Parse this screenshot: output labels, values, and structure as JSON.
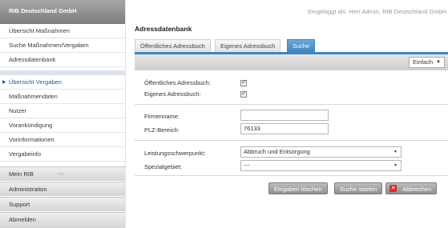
{
  "sidebar": {
    "header": "RIB Deutschland GmbH",
    "group1": [
      "Übersicht Maßnahmen",
      "Suche Maßnahmen/Vergaben",
      "Adressdatenbank"
    ],
    "group2": [
      {
        "label": "Übersicht Vergaben",
        "selected": true
      },
      {
        "label": "Maßnahmendaten",
        "selected": false
      },
      {
        "label": "Nutzer",
        "selected": false
      },
      {
        "label": "Vorankündigung",
        "selected": false
      },
      {
        "label": "Vorinformationen",
        "selected": false
      },
      {
        "label": "Vergabeinfo",
        "selected": false
      }
    ],
    "bottom": [
      "Mein RIB",
      "Administration",
      "Support",
      "Abmelden"
    ],
    "grip": "•••"
  },
  "header": {
    "login_info": "Eingeloggt als: Herr Admin, RIB Deutschland GmbH"
  },
  "main": {
    "title": "Adressdatenbank",
    "tabs": [
      {
        "label": "Öffentliches Adressbuch",
        "active": false
      },
      {
        "label": "Eigenes Adressbuch",
        "active": false
      },
      {
        "label": "Suche",
        "active": true
      }
    ],
    "mode": {
      "value": "Einfach",
      "arrow": "▼"
    },
    "form": {
      "oeffentlich_label": "Öffentliches Adressbuch:",
      "oeffentlich_checked": true,
      "eigenes_label": "Eigenes Adressbuch:",
      "eigenes_checked": true,
      "firmenname_label": "Firmenname:",
      "firmenname_value": "",
      "plz_label": "PLZ-Bereich:",
      "plz_value": "76133",
      "leistung_label": "Leistungsschwerpunkt:",
      "leistung_value": "Abbruch und Entsorgung",
      "spezial_label": "Spezialgebiet:",
      "spezial_value": "---",
      "dropdown_arrow": "▼"
    },
    "buttons": {
      "clear": "Eingaben löschen",
      "search": "Suche starten",
      "cancel": "Abbrechen",
      "cancel_icon": "✕"
    }
  }
}
